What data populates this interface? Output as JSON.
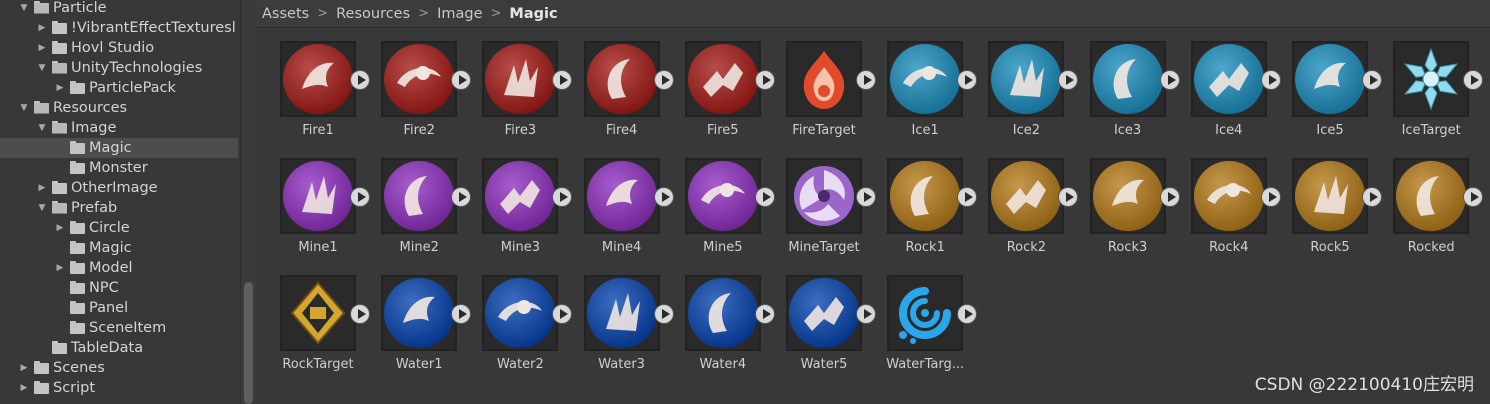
{
  "tree": {
    "items": [
      {
        "label": "Particle",
        "indent": 0,
        "expanded": true,
        "has_children": true
      },
      {
        "label": "!VibrantEffectTexturesl",
        "indent": 1,
        "expanded": false,
        "has_children": true
      },
      {
        "label": "Hovl Studio",
        "indent": 1,
        "expanded": false,
        "has_children": true
      },
      {
        "label": "UnityTechnologies",
        "indent": 1,
        "expanded": true,
        "has_children": true
      },
      {
        "label": "ParticlePack",
        "indent": 2,
        "expanded": false,
        "has_children": true
      },
      {
        "label": "Resources",
        "indent": 0,
        "expanded": true,
        "has_children": true
      },
      {
        "label": "Image",
        "indent": 1,
        "expanded": true,
        "has_children": true
      },
      {
        "label": "Magic",
        "indent": 2,
        "expanded": false,
        "has_children": false,
        "selected": true
      },
      {
        "label": "Monster",
        "indent": 2,
        "expanded": false,
        "has_children": false
      },
      {
        "label": "OtherImage",
        "indent": 1,
        "expanded": false,
        "has_children": true
      },
      {
        "label": "Prefab",
        "indent": 1,
        "expanded": true,
        "has_children": true
      },
      {
        "label": "Circle",
        "indent": 2,
        "expanded": false,
        "has_children": true
      },
      {
        "label": "Magic",
        "indent": 2,
        "expanded": false,
        "has_children": false
      },
      {
        "label": "Model",
        "indent": 2,
        "expanded": false,
        "has_children": true
      },
      {
        "label": "NPC",
        "indent": 2,
        "expanded": false,
        "has_children": false
      },
      {
        "label": "Panel",
        "indent": 2,
        "expanded": false,
        "has_children": false
      },
      {
        "label": "SceneItem",
        "indent": 2,
        "expanded": false,
        "has_children": false
      },
      {
        "label": "TableData",
        "indent": 1,
        "expanded": false,
        "has_children": false
      },
      {
        "label": "Scenes",
        "indent": 0,
        "expanded": false,
        "has_children": true
      },
      {
        "label": "Script",
        "indent": 0,
        "expanded": false,
        "has_children": true
      }
    ]
  },
  "breadcrumb": [
    "Assets",
    "Resources",
    "Image",
    "Magic"
  ],
  "breadcrumb_separator": ">",
  "assets": [
    {
      "label": "Fire1",
      "element": "fire"
    },
    {
      "label": "Fire2",
      "element": "fire"
    },
    {
      "label": "Fire3",
      "element": "fire"
    },
    {
      "label": "Fire4",
      "element": "fire"
    },
    {
      "label": "Fire5",
      "element": "fire"
    },
    {
      "label": "FireTarget",
      "element": "fire-target"
    },
    {
      "label": "Ice1",
      "element": "ice"
    },
    {
      "label": "Ice2",
      "element": "ice"
    },
    {
      "label": "Ice3",
      "element": "ice"
    },
    {
      "label": "Ice4",
      "element": "ice"
    },
    {
      "label": "Ice5",
      "element": "ice"
    },
    {
      "label": "IceTarget",
      "element": "ice-target"
    },
    {
      "label": "Mine1",
      "element": "mine"
    },
    {
      "label": "Mine2",
      "element": "mine"
    },
    {
      "label": "Mine3",
      "element": "mine"
    },
    {
      "label": "Mine4",
      "element": "mine"
    },
    {
      "label": "Mine5",
      "element": "mine"
    },
    {
      "label": "MineTarget",
      "element": "mine-target"
    },
    {
      "label": "Rock1",
      "element": "rock"
    },
    {
      "label": "Rock2",
      "element": "rock"
    },
    {
      "label": "Rock3",
      "element": "rock"
    },
    {
      "label": "Rock4",
      "element": "rock"
    },
    {
      "label": "Rock5",
      "element": "rock"
    },
    {
      "label": "Rocked",
      "element": "rock"
    },
    {
      "label": "RockTarget",
      "element": "rock-target"
    },
    {
      "label": "Water1",
      "element": "water"
    },
    {
      "label": "Water2",
      "element": "water"
    },
    {
      "label": "Water3",
      "element": "water"
    },
    {
      "label": "Water4",
      "element": "water"
    },
    {
      "label": "Water5",
      "element": "water"
    },
    {
      "label": "WaterTarg...",
      "element": "water-target"
    }
  ],
  "element_colors": {
    "fire": "#9a2f2c",
    "fire-target": "#e04a2e",
    "ice": "#2f88ad",
    "ice-target": "#7fd3e6",
    "mine": "#8a3fb0",
    "mine-target": "#9a63c8",
    "rock": "#a77a2e",
    "rock-target": "#c99a2a",
    "water": "#1e4fa3",
    "water-target": "#2a9fe0"
  },
  "watermark": "CSDN @222100410庄宏明"
}
